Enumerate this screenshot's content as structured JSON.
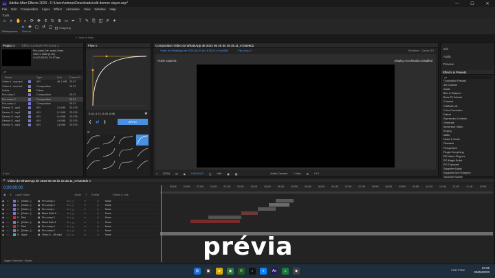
{
  "window": {
    "app_icon": "Ae",
    "title": "Adobe After Effects 2020 - C:\\Users\\odmar\\Downloads\\edit demon slayer.aep*",
    "controls": [
      "—",
      "☐",
      "✕"
    ]
  },
  "menu": [
    "File",
    "Edit",
    "Composition",
    "Layer",
    "Effect",
    "Animation",
    "View",
    "Window",
    "Help"
  ],
  "tools_label": "Tools",
  "toolbar": {
    "workspace_label": "Workspaces:",
    "workspace_value": "Default",
    "search_placeholder": "Search Help",
    "snapping": "Snapping"
  },
  "project": {
    "tab": "Project ≡",
    "tab2": "Effect Controls Pre-comp 2",
    "selected_name": "Pre-comp 3 ▾, used 1 time",
    "selected_info1": "1920 x 1080 (1.00)",
    "selected_info2": "Δ 0;00;02;20, 29.97 fps",
    "search_placeholder": "ρ▾",
    "columns": [
      "Name",
      "",
      "Type",
      "Size",
      "Frame R..."
    ],
    "items": [
      {
        "name": "Vídeo d...ing.mp4",
        "color": "#7a7ac0",
        "type": "AVI",
        "size": "46.1 MB",
        "fr": "29.97"
      },
      {
        "name": "Vídeo d...etsd.avi",
        "color": "#7a7ac0",
        "type": "Composition",
        "size": "",
        "fr": "29.97"
      },
      {
        "name": "Solids",
        "color": "#d8c050",
        "type": "Folder",
        "size": "",
        "fr": ""
      },
      {
        "name": "Pre-comp 1",
        "color": "#7a7ac0",
        "type": "Composition",
        "size": "",
        "fr": "29.97"
      },
      {
        "name": "Pre-comp 3",
        "color": "#7a7ac0",
        "type": "Composition",
        "size": "",
        "fr": "29.97"
      },
      {
        "name": "Pre-comp 4",
        "color": "#7a7ac0",
        "type": "Composition",
        "size": "",
        "fr": "29.97"
      },
      {
        "name": "Demon S...mp4",
        "color": "#7a7ac0",
        "type": "AVI",
        "size": "2.9 MB",
        "fr": "23.976"
      },
      {
        "name": "Demon S...mp4",
        "color": "#7a7ac0",
        "type": "AVI",
        "size": "5.1 MB",
        "fr": "23.976"
      },
      {
        "name": "Demon S...mp4",
        "color": "#7a7ac0",
        "type": "AVI",
        "size": "5.4 MB",
        "fr": "23.976"
      },
      {
        "name": "Demon S...mp4",
        "color": "#7a7ac0",
        "type": "AVI",
        "size": "4.6 MB",
        "fr": "23.976"
      },
      {
        "name": "Demon S...mp4",
        "color": "#7a7ac0",
        "type": "AVI",
        "size": "3.8 MB",
        "fr": "23.976"
      }
    ],
    "footer": "8 bpc"
  },
  "flow": {
    "tab": "Flow ≡",
    "bezier_values": "0.01, 0.71, 0.25, 0.98",
    "apply": "APPLY",
    "nav_left": "❮",
    "nav_right": "❯"
  },
  "comp": {
    "tab": "Composition Vídeo do WhatsApp de 2023 06 29 às 16.35.11_e7a4e9d1",
    "subtab1": "Vídeo do WhatsApp de 2023-06-29 às 16.35.11_e7a4e9d1",
    "subtab2": "Pre-comp 2",
    "renderer": "Renderer:",
    "renderer_value": "Classic 3D",
    "active_camera": "Active Camera",
    "display_accel": "Display Acceleration Disabled",
    "zoom": "(25%)",
    "timecode": "0;00;00;00",
    "quality": "Half",
    "view_camera": "Active Camera",
    "views": "1 View",
    "offset": "+0.0"
  },
  "right": {
    "items": [
      "Info",
      "Audio",
      "Preview"
    ],
    "effects_title": "Effects & Presets",
    "search_placeholder": "ρ▾",
    "effects": [
      "* Animation Presets",
      "3D Channel",
      "Audio",
      "Blur & Sharpen",
      "Boris FX Mocha",
      "Channel",
      "CINEMA 4D",
      "Color Correction",
      "Distort",
      "Expression Controls",
      "Generate",
      "Immersive Video",
      "Keying",
      "Matte",
      "Noise & Grain",
      "Obsolete",
      "Perspective",
      "Plugin Everything",
      "RE:Vision Plug-ins",
      "RG Magic Bullet",
      "RG Trapcode",
      "Sapphire Adjust",
      "Sapphire Blur+Sharpen",
      "Sapphire Builder"
    ]
  },
  "timeline": {
    "tab": "Vídeo do WhatsApp de 2023-06-29 às 16.35.11_e7a4e9d1 ≡",
    "timecode": "0;00;00;00",
    "columns": [
      "#",
      "Layer Name",
      "",
      "Mode",
      "T",
      "TrkMat",
      "",
      "Parent & Link"
    ],
    "layers": [
      {
        "n": "1",
        "name": "[Vídeo...]",
        "color": "#7a7ac0",
        "mode": "",
        "parent": "None"
      },
      {
        "n": "2",
        "name": "[Vídeo...]",
        "color": "#7a7ac0",
        "mode": "",
        "parent": "None"
      },
      {
        "n": "3",
        "name": "[Vídeo...]",
        "color": "#7a7ac0",
        "mode": "",
        "parent": "None"
      },
      {
        "n": "4",
        "name": "[Vídeo...]",
        "color": "#7a7ac0",
        "mode": "",
        "parent": "None"
      },
      {
        "n": "5",
        "name": "Red",
        "color": "#c03030",
        "mode": "",
        "parent": "None"
      },
      {
        "n": "6",
        "name": "[Vídeo...]",
        "color": "#7a7ac0",
        "mode": "",
        "parent": "None"
      },
      {
        "n": "7",
        "name": "Red",
        "color": "#c03030",
        "mode": "",
        "parent": "None"
      },
      {
        "n": "8",
        "name": "[Vídeo...]",
        "color": "#7a7ac0",
        "mode": "",
        "parent": "None"
      },
      {
        "n": "9",
        "name": "Aqua",
        "color": "#40b0b0",
        "mode": "",
        "parent": "None"
      }
    ],
    "sources": [
      "Pre-comp 3",
      "Pre-comp 2",
      "Pre-comp 1",
      "Black Solid 3",
      "Pre-comp 3",
      "Black Solid 1",
      "Pre-comp 4",
      "Pre-comp 3",
      "Vídeo d...-Dlt.mp4"
    ],
    "ticks": [
      "00:15f",
      "01:00f",
      "01:15f",
      "02:00f",
      "02:15f",
      "03:00f",
      "03:15f",
      "04:00f",
      "04:15f",
      "05:00f",
      "05:15f",
      "06:00f",
      "06:15f",
      "07:00f",
      "07:15f",
      "08:00f",
      "08:15f",
      "09:00f",
      "09:15f",
      "10:00f",
      "10:15f",
      "11:00f",
      "11:15f",
      "12:00f"
    ],
    "footer": "Toggle Switches / Modes",
    "caption": "prévia"
  },
  "taskbar": {
    "time": "23:35",
    "date": "29/06/2023",
    "lang": "POR PTB2"
  }
}
